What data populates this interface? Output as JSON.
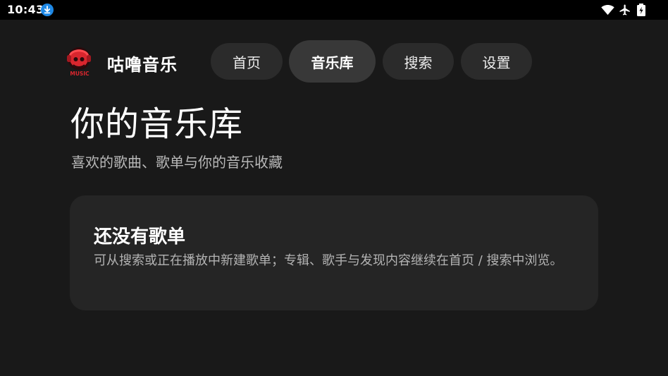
{
  "status_bar": {
    "time": "10:43",
    "icons": [
      "download-icon",
      "wifi-icon",
      "airplane-mode-icon",
      "battery-charging-icon"
    ],
    "download_badge_color": "#1e88e5"
  },
  "header": {
    "logo_text": "MUSIC",
    "app_title": "咕噜音乐",
    "tabs": [
      {
        "label": "首页",
        "active": false
      },
      {
        "label": "音乐库",
        "active": true
      },
      {
        "label": "搜索",
        "active": false
      },
      {
        "label": "设置",
        "active": false
      }
    ]
  },
  "main": {
    "title": "你的音乐库",
    "subtitle": "喜欢的歌曲、歌单与你的音乐收藏",
    "empty_card": {
      "title": "还没有歌单",
      "description": "可从搜索或正在播放中新建歌单；专辑、歌手与发现内容继续在首页 / 搜索中浏览。"
    }
  },
  "colors": {
    "background": "#191919",
    "card": "#252525",
    "tab": "#2b2b2b",
    "tab_active": "#383838",
    "logo_accent": "#d9262e"
  }
}
